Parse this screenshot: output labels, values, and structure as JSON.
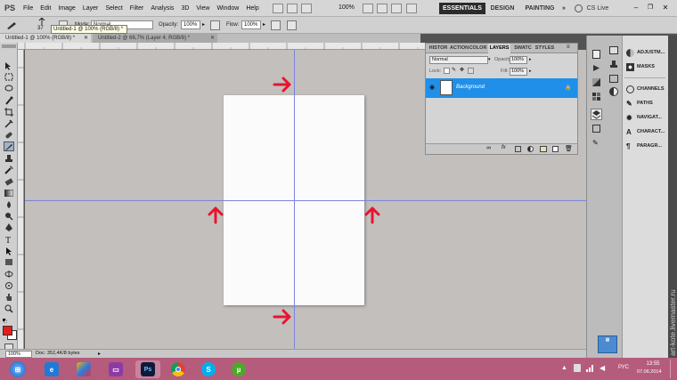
{
  "app": {
    "logo": "PS"
  },
  "menu": [
    "File",
    "Edit",
    "Image",
    "Layer",
    "Select",
    "Filter",
    "Analysis",
    "3D",
    "View",
    "Window",
    "Help"
  ],
  "zoom_menu": "100%",
  "workspaces": {
    "active": "ESSENTIALS",
    "design": "DESIGN",
    "painting": "PAINTING",
    "more": "»",
    "cslive": "CS Live"
  },
  "options": {
    "brush_size": "37",
    "mode_label": "Mode:",
    "mode_value": "Normal",
    "opacity_label": "Opacity:",
    "opacity_value": "100%",
    "flow_label": "Flow:",
    "flow_value": "100%"
  },
  "tabs": [
    {
      "label": "Untitled-1 @ 100% (RGB/8) *"
    },
    {
      "label": "Untitled-2 @ 66,7% (Layer 4, RGB/8) *"
    }
  ],
  "tooltip": "Untitled-1 @ 100% (RGB/8) *",
  "status": {
    "zoom": "100%",
    "doc": "Doc: 352,4K/8 bytes"
  },
  "layers_panel": {
    "tabs": [
      "HISTOR",
      "ACTION",
      "COLOR",
      "LAYERS",
      "SWATC",
      "STYLES"
    ],
    "blend_mode": "Normal",
    "opacity_label": "Opacity:",
    "opacity_value": "100%",
    "lock_label": "Lock:",
    "fill_label": "Fill:",
    "fill_value": "100%",
    "layers": [
      {
        "name": "Background",
        "selected": true
      }
    ]
  },
  "dock": {
    "items": [
      "ADJUSTM...",
      "MASKS",
      "CHANNELS",
      "PATHS",
      "NAVIGAT...",
      "CHARACT...",
      "PARAGR..."
    ]
  },
  "watermark": "art-kote.livemaster.ru",
  "taskbar": {
    "language": "РУС",
    "time": "13:55",
    "date": "07.06.2014"
  },
  "colors": {
    "menubar_bg": "#d6d6d6",
    "canvas_bg": "#c2bfbd",
    "guide": "#7a83e0",
    "arrow": "#e8142e",
    "layer_selected": "#1f8fe9",
    "taskbar": "#b55c7c",
    "foreground_swatch": "#e81b1b"
  }
}
